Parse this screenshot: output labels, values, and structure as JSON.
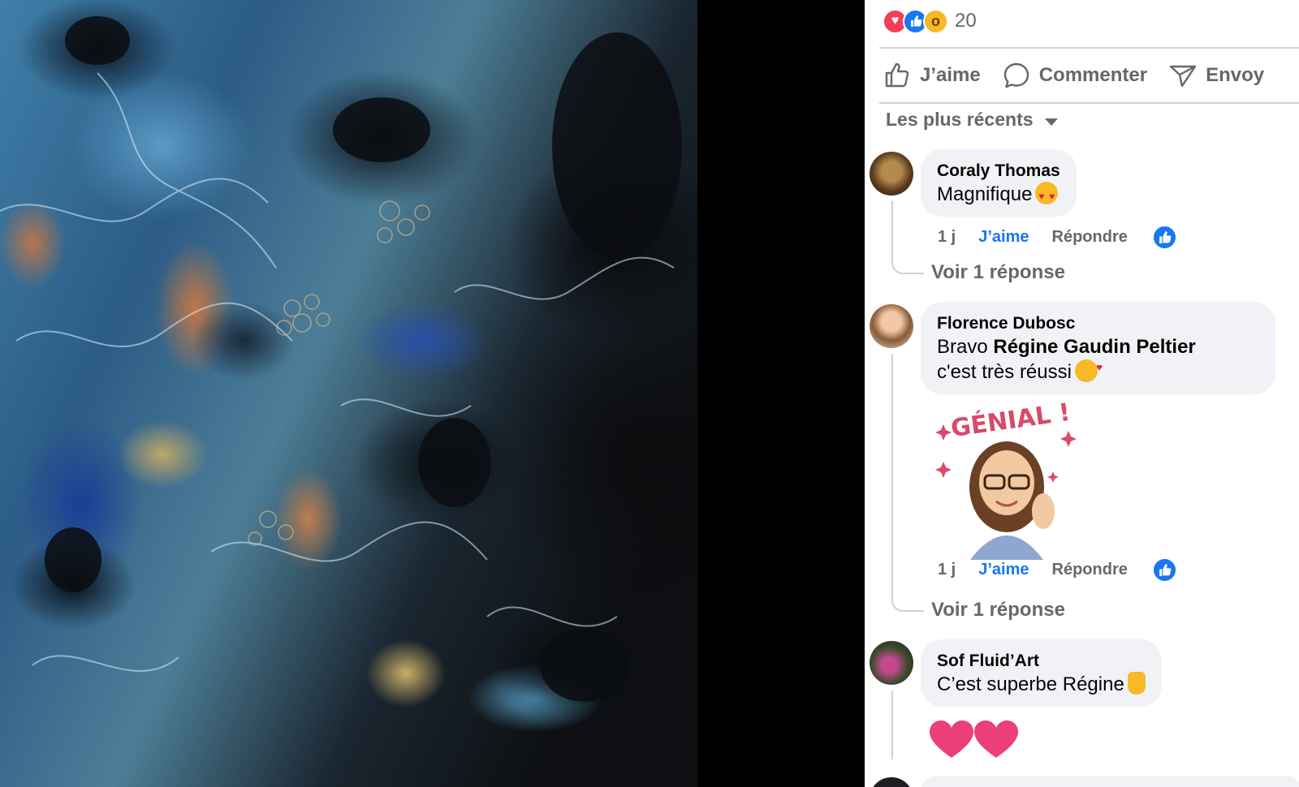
{
  "post": {
    "reactions": {
      "icons": [
        "love-reaction",
        "like-reaction",
        "wow-reaction"
      ],
      "count": "20"
    },
    "actions": {
      "like": "J’aime",
      "comment": "Commenter",
      "send": "Envoy"
    },
    "sort_label": "Les plus récents"
  },
  "comments": [
    {
      "author": "Coraly Thomas",
      "text": "Magnifique",
      "time": "1 j",
      "like": "J’aime",
      "reply": "Répondre",
      "replies": "Voir 1 réponse"
    },
    {
      "author": "Florence Dubosc",
      "text_prefix": "Bravo",
      "mention": "Régine Gaudin Peltier",
      "text_suffix": "c'est très réussi",
      "sticker_text": "GÉNIAL !",
      "time": "1 j",
      "like": "J’aime",
      "reply": "Répondre",
      "replies": "Voir 1 réponse"
    },
    {
      "author": "Sof Fluid’Art",
      "text": "C’est superbe Régine"
    }
  ],
  "colors": {
    "accent": "#1877f2",
    "secondary_text": "#65676b",
    "bubble": "#f0f2f5",
    "love": "#f33e58"
  }
}
